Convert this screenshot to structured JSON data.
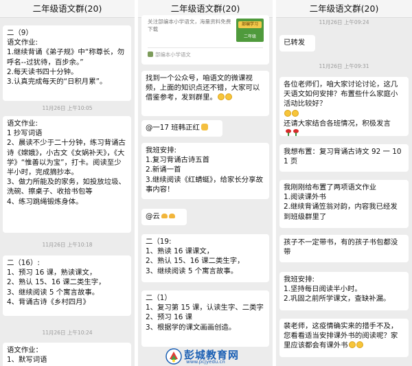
{
  "watermark": {
    "title": "彭城教育网",
    "url": "www.pcjyedu.cn"
  },
  "columns": [
    {
      "title": "二年级语文群(20)",
      "messages": [
        {
          "lines": [
            "二（9）",
            "语文作业:",
            "1.继续背诵《弟子规》中“称尊长，勿呼名--过犹待，百步余。”",
            "2.每天读书四十分钟。",
            "3.认真完成每天的“日积月累”。"
          ]
        },
        {
          "lines": [
            "语文作业:",
            "1 抄写词语",
            "2、晨读不少于二十分钟，练习背诵古诗《嫦娥》，小古文《女娲补天》，《大学》“惟善以为宝”，打卡。阅读至少半小时，完成摘抄本。",
            "3、做力所能及的家务，如投放垃圾、洗碗、擦桌子、收拾书包等",
            "4、练习跳绳锻炼身体。"
          ]
        },
        {
          "lines": [
            "二（16）:",
            "1、预习 16 课，熟读课文，",
            "2、熟认 15、16 课二类生字，",
            "3、继续阅读 5 个寓言故事。",
            "4、背诵古诗《乡村四月》"
          ]
        },
        {
          "lines": [
            "语文作业：",
            "1、默写词语"
          ]
        }
      ],
      "timestamps": [
        "11月26日 上午10:05",
        "11月26日 上午10:18",
        "11月26日 上午10:24"
      ]
    },
    {
      "title": "二年级语文群(20)",
      "card": {
        "text": "关注部编本小学语文，海量资料免费下载",
        "thumb_top": "部编学习",
        "thumb_bottom": "二年级",
        "source": "部编本小学语文"
      },
      "messages": [
        {
          "lines": [
            "找到一个公众号，咱语文的微课视频，上面的知识点还不错，大家可以借鉴参考，发到群里。"
          ]
        },
        {
          "lines": [
            "@一17 班韩正红"
          ]
        },
        {
          "lines": [
            "我班安排:",
            "1.复习背诵古诗五首",
            "2.新诵一首",
            "3.继续阅读《红蜻蜓》，给家长分享故事内容！"
          ]
        },
        {
          "lines": [
            "@云"
          ]
        },
        {
          "lines": [
            "二（19:",
            "1、熟读 16 课课文，",
            "2、熟认 15、16 课二类生字，",
            "3、继续阅读 5 个寓言故事。"
          ]
        },
        {
          "lines": [
            "二（1）",
            "1、复习第 15 课，认读生字、二类字",
            "2、预习 16 课",
            "3、根据学的课文画画创造。"
          ]
        }
      ]
    },
    {
      "title": "二年级语文群(20)",
      "timestamps": [
        "11月26日 上午09:24",
        "11月26日 上午09:31"
      ],
      "messages": [
        {
          "lines": [
            "已转发"
          ]
        },
        {
          "lines": [
            "各位老师们，咱大家讨论讨论，这几天语文如何安排？布置些什么家庭小活动比较好？",
            "还请大家结合各班情况，积极发言"
          ]
        },
        {
          "lines": [
            "我想布置：复习背诵古诗文 92 一 101 页"
          ]
        },
        {
          "lines": [
            "我刚刚给布置了两项语文作业",
            "1.阅读课外书",
            "2.继续背诵笠翁对韵，内容我已经发到班级群里了"
          ]
        },
        {
          "lines": [
            "孩子不一定带书，有的孩子书包都没带"
          ]
        },
        {
          "lines": [
            "我班安排:",
            "1.坚持每日阅读半小时。",
            "2.巩固之前所学课文，查缺补漏。"
          ]
        },
        {
          "lines": [
            "裴老师，这疫情确实来的措手不及，您看看适当安排课外书的阅读呢？家里应该都会有课外书"
          ]
        }
      ]
    }
  ]
}
